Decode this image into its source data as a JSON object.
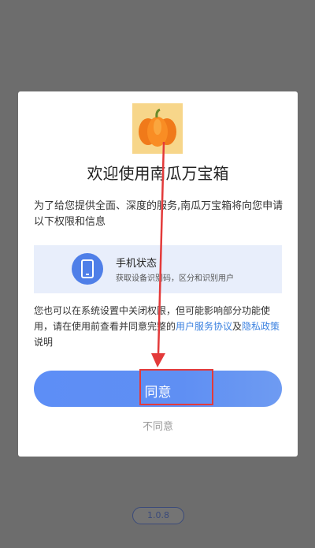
{
  "dialog": {
    "title": "欢迎使用南瓜万宝箱",
    "intro": "为了给您提供全面、深度的服务,南瓜万宝箱将向您申请以下权限和信息",
    "permission": {
      "title": "手机状态",
      "description": "获取设备识别码，区分和识别用户",
      "icon": "phone-icon"
    },
    "notice_prefix": "您也可以在系统设置中关闭权限，但可能影响部分功能使用，请在使用前查看并同意完整的",
    "user_agreement_link": "用户服务协议",
    "notice_and": "及",
    "privacy_link": "隐私政策",
    "notice_suffix": "说明",
    "agree_label": "同意",
    "disagree_label": "不同意",
    "logo_icon": "pumpkin-icon"
  },
  "footer": {
    "version": "1.0.8"
  },
  "colors": {
    "accent": "#5d8ef6",
    "link": "#3c82e0",
    "annotation": "#e33a3a"
  }
}
